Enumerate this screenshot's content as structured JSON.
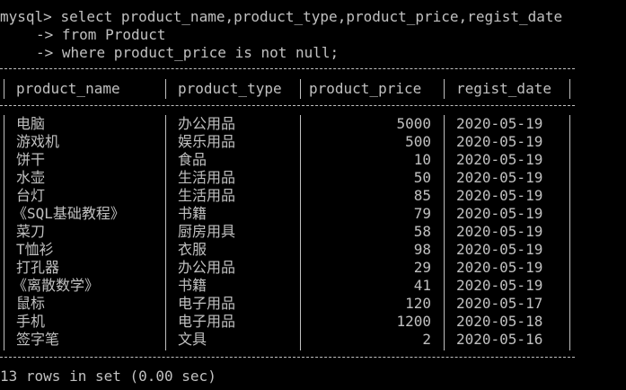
{
  "prompt": "mysql>",
  "continuation": "->",
  "query_lines": [
    "select product_name,product_type,product_price,regist_date",
    "from Product",
    "where product_price is not null;"
  ],
  "table": {
    "columns": [
      "product_name",
      "product_type",
      "product_price",
      "regist_date"
    ],
    "rows": [
      [
        "电脑",
        "办公用品",
        "5000",
        "2020-05-19"
      ],
      [
        "游戏机",
        "娱乐用品",
        "500",
        "2020-05-19"
      ],
      [
        "饼干",
        "食品",
        "10",
        "2020-05-19"
      ],
      [
        "水壶",
        "生活用品",
        "50",
        "2020-05-19"
      ],
      [
        "台灯",
        "生活用品",
        "85",
        "2020-05-19"
      ],
      [
        "《SQL基础教程》",
        "书籍",
        "79",
        "2020-05-19"
      ],
      [
        "菜刀",
        "厨房用具",
        "58",
        "2020-05-19"
      ],
      [
        "T恤衫",
        "衣服",
        "98",
        "2020-05-19"
      ],
      [
        "打孔器",
        "办公用品",
        "29",
        "2020-05-19"
      ],
      [
        "《离散数学》",
        "书籍",
        "41",
        "2020-05-19"
      ],
      [
        "鼠标",
        "电子用品",
        "120",
        "2020-05-17"
      ],
      [
        "手机",
        "电子用品",
        "1200",
        "2020-05-18"
      ],
      [
        "签字笔",
        "文具",
        "2",
        "2020-05-16"
      ]
    ]
  },
  "status": "13 rows in set (0.00 sec)",
  "colors": {
    "background": "#000000",
    "text": "#c0c0c0"
  }
}
